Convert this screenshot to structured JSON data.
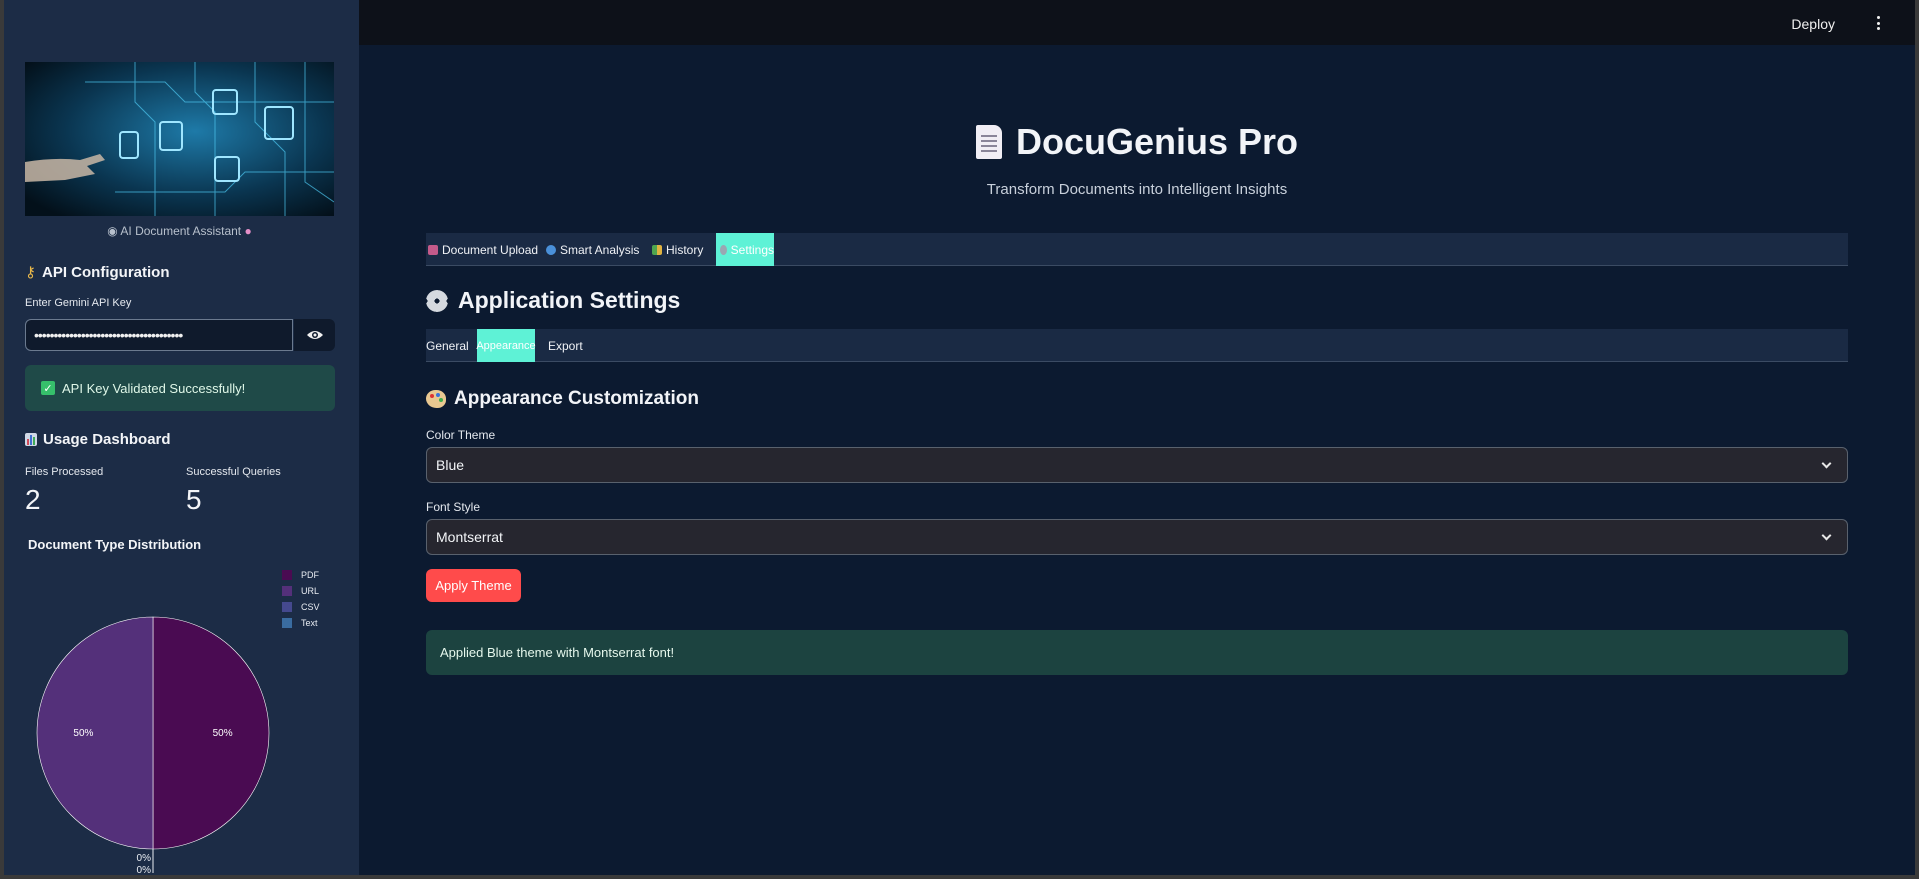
{
  "header": {
    "deploy_label": "Deploy",
    "menu_icon": "kebab-menu-icon"
  },
  "sidebar": {
    "image_caption": "AI Document Assistant",
    "api_section_title": "API Configuration",
    "api_key_label": "Enter Gemini API Key",
    "api_key_value": "••••••••••••••••••••••••••••••••••••••",
    "api_success": "API Key Validated Successfully!",
    "usage_title": "Usage Dashboard",
    "metrics": [
      {
        "label": "Files Processed",
        "value": "2"
      },
      {
        "label": "Successful Queries",
        "value": "5"
      }
    ]
  },
  "chart_data": {
    "type": "pie",
    "title": "Document Type Distribution",
    "categories": [
      "PDF",
      "URL",
      "CSV",
      "Text"
    ],
    "values": [
      50,
      50,
      0,
      0
    ],
    "labels": [
      "50%",
      "50%",
      "0%",
      "0%"
    ],
    "colors": [
      "#4a0b52",
      "#54307a",
      "#45498e",
      "#3a6ca0"
    ],
    "legend_position": "top-right"
  },
  "main": {
    "title": "DocuGenius Pro",
    "subtitle": "Transform Documents into Intelligent Insights",
    "tabs": [
      {
        "label": "Document Upload",
        "active": false
      },
      {
        "label": "Smart Analysis",
        "active": false
      },
      {
        "label": "History",
        "active": false
      },
      {
        "label": "Settings",
        "active": true
      }
    ],
    "settings_title": "Application Settings",
    "subtabs": [
      {
        "label": "General",
        "active": false
      },
      {
        "label": "Appearance",
        "active": true
      },
      {
        "label": "Export",
        "active": false
      }
    ],
    "appearance_title": "Appearance Customization",
    "color_theme_label": "Color Theme",
    "color_theme_value": "Blue",
    "font_style_label": "Font Style",
    "font_style_value": "Montserrat",
    "apply_button": "Apply Theme",
    "applied_message": "Applied Blue theme with Montserrat font!"
  },
  "colors": {
    "accent": "#ff4b4b",
    "active_tab": "#5ef2d6",
    "background": "#0c1a30",
    "sidebar": "#1c2c46",
    "success_bg": "#1c4340"
  }
}
